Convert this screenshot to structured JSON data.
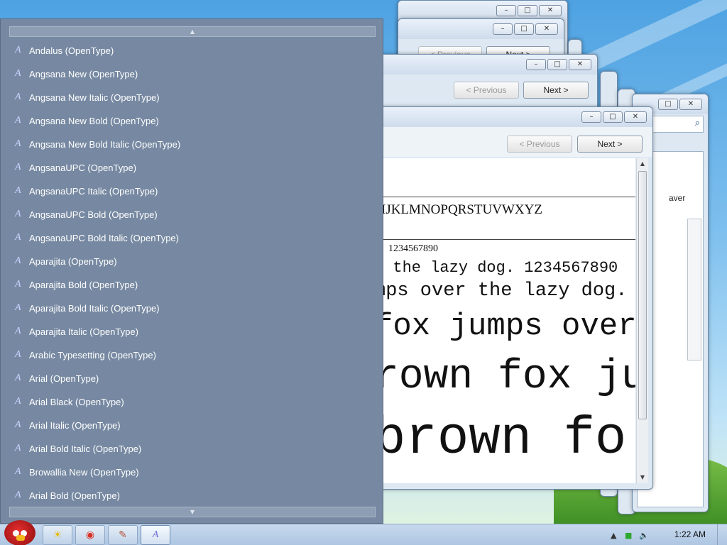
{
  "windows": {
    "back": {
      "previous_label": "< Previous",
      "next_label": "Next >"
    },
    "middle": {
      "previous_label": "< Previous",
      "next_label": "Next >"
    },
    "main": {
      "previous_label": "< Previous",
      "next_label": "Next >",
      "preview_lines": [
        "IJKLMNOPQRSTUVWXYZ",
        "1234567890",
        "r the lazy dog. 1234567890",
        "mps over the lazy dog.",
        "fox jumps over",
        "rown fox ju",
        "brown fo"
      ]
    },
    "right": {
      "fragment_text": "aver"
    }
  },
  "font_panel": {
    "scroll_up_glyph": "▲",
    "scroll_down_glyph": "▼",
    "items": [
      "Andalus (OpenType)",
      "Angsana New (OpenType)",
      "Angsana New Italic (OpenType)",
      "Angsana New Bold (OpenType)",
      "Angsana New Bold Italic (OpenType)",
      "AngsanaUPC (OpenType)",
      "AngsanaUPC Italic (OpenType)",
      "AngsanaUPC Bold (OpenType)",
      "AngsanaUPC Bold Italic (OpenType)",
      "Aparajita (OpenType)",
      "Aparajita Bold (OpenType)",
      "Aparajita Bold Italic (OpenType)",
      "Aparajita Italic (OpenType)",
      "Arabic Typesetting (OpenType)",
      "Arial (OpenType)",
      "Arial Black (OpenType)",
      "Arial Italic (OpenType)",
      "Arial Bold Italic (OpenType)",
      "Browallia New (OpenType)",
      "Arial Bold (OpenType)"
    ]
  },
  "taskbar": {
    "clock": "1:22 AM"
  },
  "colors": {
    "panel_bg": "#7789a2",
    "panel_text": "#ffffff",
    "taskbar": "#bcd0e8"
  }
}
